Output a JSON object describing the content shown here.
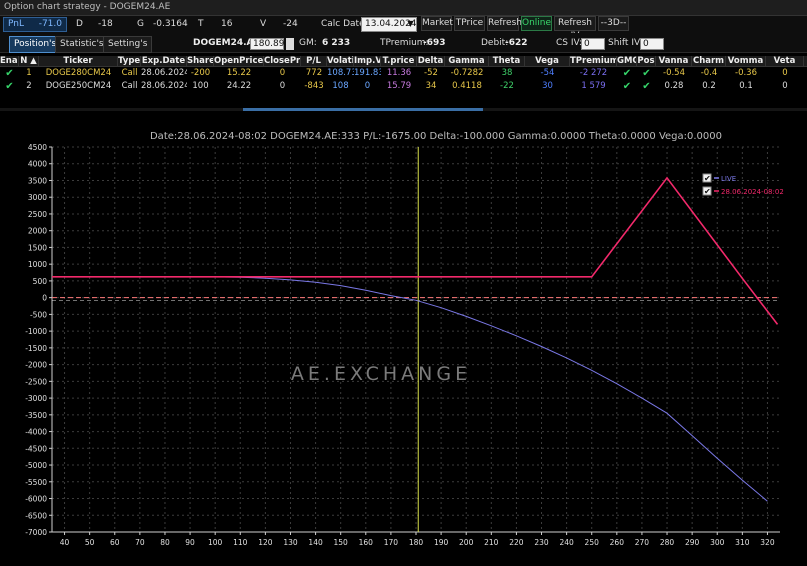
{
  "window": {
    "title": "Option chart strategy - DOGEM24.AE"
  },
  "summary": {
    "pnl_label": "PnL",
    "pnl_value": "-71.0",
    "d_label": "D",
    "d_value": "-18",
    "g_label": "G",
    "g_value": "-0.3164",
    "t_label": "T",
    "t_value": "16",
    "v_label": "V",
    "v_value": "-24",
    "calc_date_label": "Calc Date:",
    "calc_date_value": "13.04.2024",
    "market_btn": "Market",
    "tprice_btn": "TPrice",
    "refresh_btn": "Refresh",
    "online_btn": "Online",
    "refresh_iv_btn": "Refresh IV",
    "view_btn": "--3D--"
  },
  "toolbar": {
    "tab_positions": "Position's",
    "tab_statistics": "Statistic's",
    "tab_settings": "Setting's",
    "symbol": "DOGEM24.AE",
    "symbol_price": "180.89",
    "gm_label": "GM:",
    "gm_value": "6 233",
    "tpremium_label": "TPremium:",
    "tpremium_value": "-693",
    "debit_label": "Debit:",
    "debit_value": "-622",
    "cs_iv_label": "CS IV:",
    "cs_iv_value": "0",
    "shift_iv_label": "Shift IV:",
    "shift_iv_value": "0"
  },
  "table": {
    "headers": [
      "Enal",
      "N ▲",
      "Ticker",
      "Type",
      "Exp.Date",
      "Shares",
      "OpenPrice",
      "ClosePri",
      "P/L",
      "Volatil",
      "Imp.Vo",
      "T.price",
      "Delta",
      "Gamma",
      "Theta",
      "Vega",
      "TPremium",
      "GMO",
      "Pos",
      "Vanna",
      "Charm",
      "Vomma",
      "Veta"
    ],
    "rows": [
      {
        "enabled": "✔",
        "n": "1",
        "ticker": "DOGE280CM24",
        "type": "Call",
        "exp": "28.06.2024",
        "shares": "-200",
        "open": "15.22",
        "close": "0",
        "pl": "772",
        "volatil": "108.73",
        "impvo": "191.83",
        "tprice": "11.36",
        "delta": "-52",
        "gamma": "-0.7282",
        "theta": "38",
        "vega": "-54",
        "tpremium": "-2 272",
        "gmo": "✔",
        "pos": "✔",
        "vanna": "-0.54",
        "charm": "-0.4",
        "vomma": "-0.36",
        "veta": "0"
      },
      {
        "enabled": "✔",
        "n": "2",
        "ticker": "DOGE250CM24",
        "type": "Call",
        "exp": "28.06.2024",
        "shares": "100",
        "open": "24.22",
        "close": "0",
        "pl": "-843",
        "volatil": "108",
        "impvo": "0",
        "tprice": "15.79",
        "delta": "34",
        "gamma": "0.4118",
        "theta": "-22",
        "vega": "30",
        "tpremium": "1 579",
        "gmo": "✔",
        "pos": "✔",
        "vanna": "0.28",
        "charm": "0.2",
        "vomma": "0.1",
        "veta": "0"
      }
    ]
  },
  "chart_data": {
    "type": "line",
    "title": "Date:28.06.2024-08:02  DOGEM24.AE:333  P/L:-1675.00  Delta:-100.000  Gamma:0.0000  Theta:0.0000  Vega:0.0000",
    "watermark": "AE.EXCHANGE",
    "xlim": [
      35,
      325
    ],
    "ylim": [
      -7000,
      4500
    ],
    "x_ticks": [
      40,
      50,
      60,
      70,
      80,
      90,
      100,
      110,
      120,
      130,
      140,
      150,
      160,
      170,
      180,
      190,
      200,
      210,
      220,
      230,
      240,
      250,
      260,
      270,
      280,
      290,
      300,
      310,
      320
    ],
    "y_ticks": [
      4500,
      4000,
      3500,
      3000,
      2500,
      2000,
      1500,
      1000,
      500,
      0,
      -500,
      -1000,
      -1500,
      -2000,
      -2500,
      -3000,
      -3500,
      -4000,
      -4500,
      -5000,
      -5500,
      -6000,
      -6500,
      -7000
    ],
    "current_price": 180.89,
    "zero_line_color": "#ff7a7a",
    "vline_color": "#d9e04a",
    "grid": true,
    "legend_position": "top-right",
    "series": [
      {
        "name": "LIVE",
        "color": "#7a78e6",
        "x": [
          100,
          110,
          120,
          130,
          140,
          150,
          160,
          170,
          180,
          190,
          200,
          210,
          220,
          230,
          240,
          250,
          260,
          270,
          280,
          290,
          300,
          310,
          320
        ],
        "y": [
          620,
          610,
          580,
          530,
          460,
          360,
          220,
          60,
          -80,
          -300,
          -560,
          -840,
          -1140,
          -1460,
          -1800,
          -2170,
          -2570,
          -3000,
          -3450,
          -4120,
          -4800,
          -5450,
          -6080
        ]
      },
      {
        "name": "28.06.2024-08:02",
        "color": "#f2296b",
        "x": [
          35,
          250,
          280,
          310,
          324
        ],
        "y": [
          622,
          622,
          3578,
          578,
          -800
        ]
      }
    ]
  }
}
